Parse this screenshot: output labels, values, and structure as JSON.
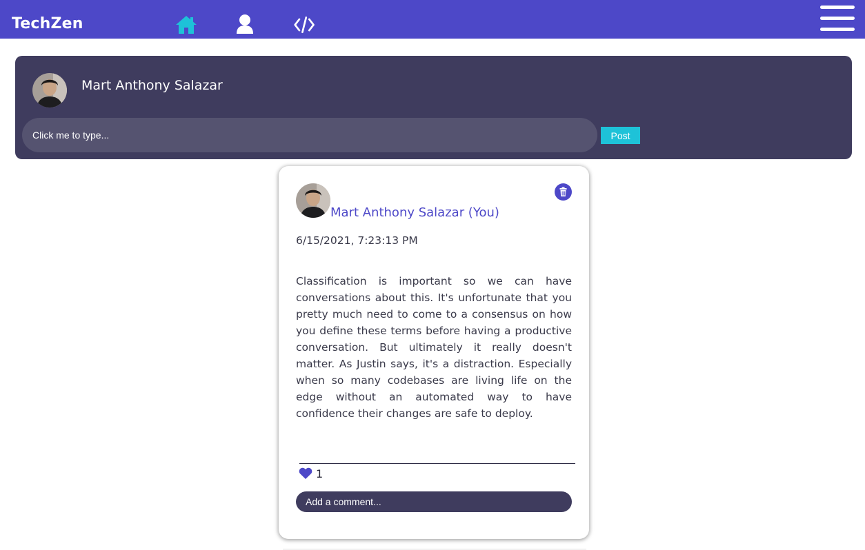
{
  "app": {
    "brand": "TechZen"
  },
  "nav": {
    "icons": [
      "home-icon",
      "user-icon",
      "code-icon",
      "hamburger-menu-icon"
    ]
  },
  "composer": {
    "user_name": "Mart Anthony Salazar",
    "input_placeholder": "Click me to type...",
    "post_label": "Post"
  },
  "post": {
    "author": "Mart Anthony Salazar (You)",
    "timestamp": "6/15/2021, 7:23:13 PM",
    "body": "Classification is important so we can have conversations about this. It's unfortunate that you pretty much need to come to a consensus on how you define these terms before having a productive conversation. But ultimately it really doesn't matter. As Justin says, it's a distraction. Especially when so many codebases are living life on the edge without an automated way to have confidence their changes are safe to deploy.",
    "likes": "1",
    "comment_placeholder": "Add a comment..."
  },
  "colors": {
    "navbar": "#4d48c8",
    "accent_teal": "#1ec2d8",
    "panel_dark": "#3f3c5e",
    "author_link": "#4d48c8"
  }
}
